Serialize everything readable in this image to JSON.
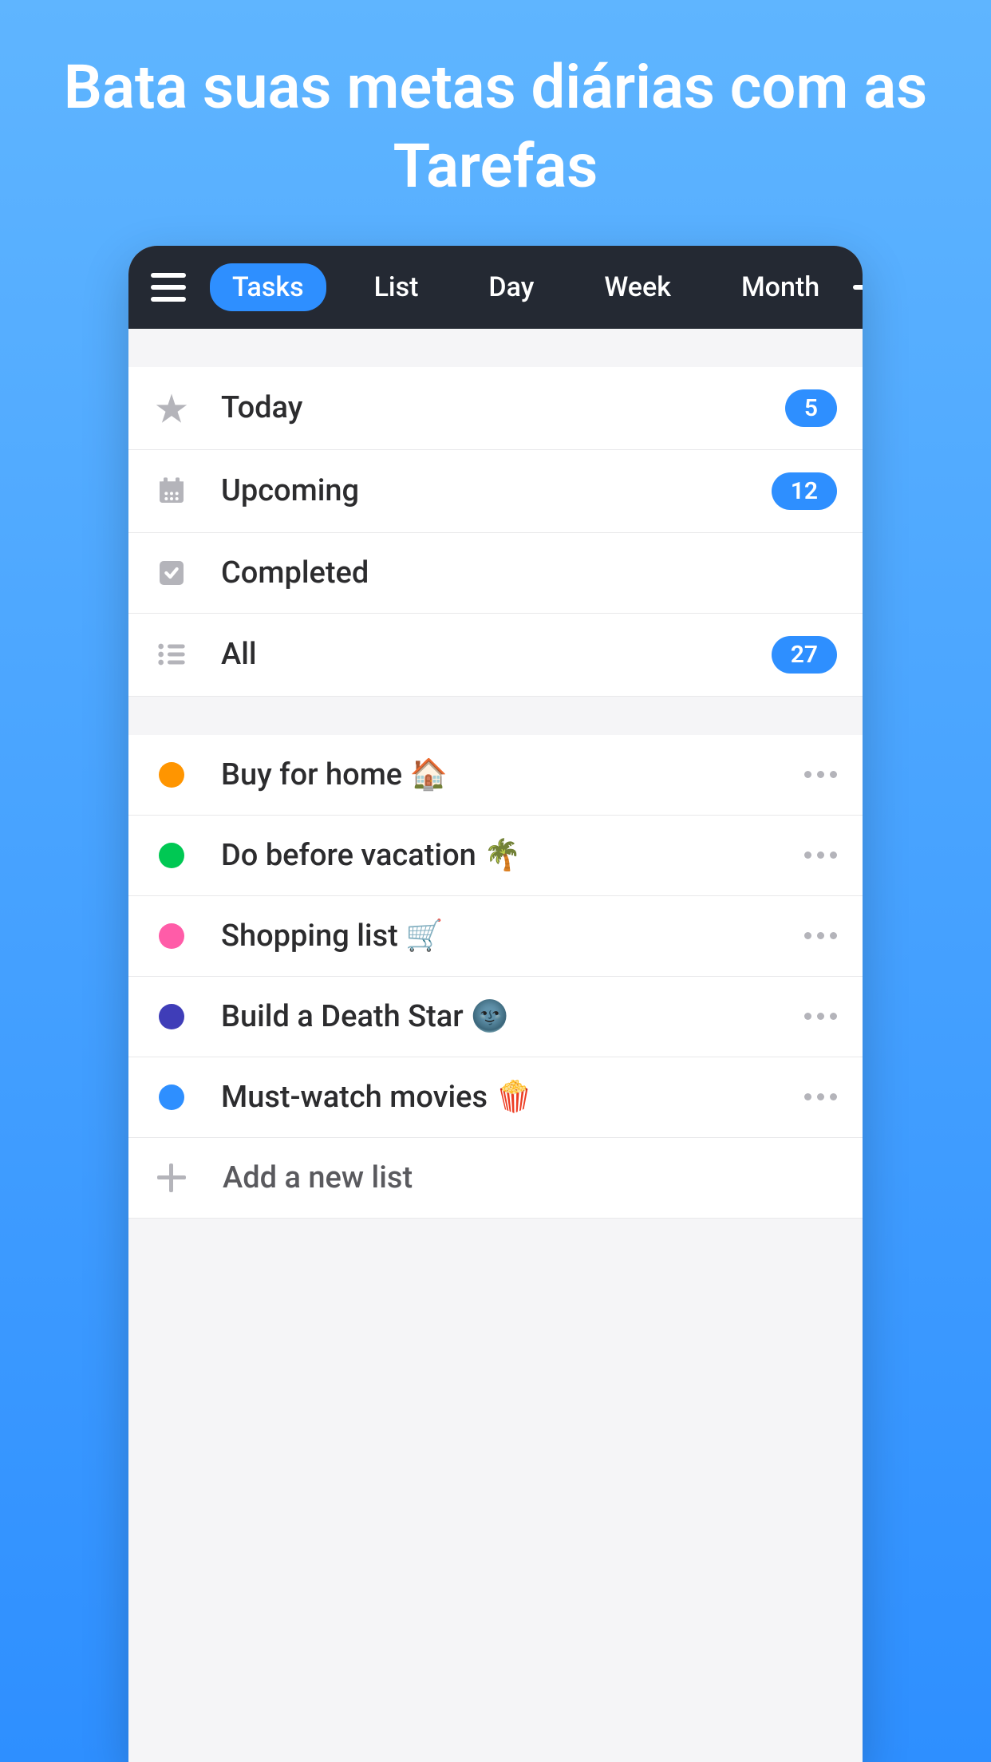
{
  "headline": "Bata suas metas diárias com as Tarefas",
  "header": {
    "tabs": [
      {
        "label": "Tasks",
        "active": true
      },
      {
        "label": "List",
        "active": false
      },
      {
        "label": "Day",
        "active": false
      },
      {
        "label": "Week",
        "active": false
      },
      {
        "label": "Month",
        "active": false
      }
    ]
  },
  "smartLists": [
    {
      "icon": "star",
      "label": "Today",
      "count": 5
    },
    {
      "icon": "calendar",
      "label": "Upcoming",
      "count": 12
    },
    {
      "icon": "check",
      "label": "Completed",
      "count": null
    },
    {
      "icon": "list",
      "label": "All",
      "count": 27
    }
  ],
  "userLists": [
    {
      "color": "#ff9500",
      "label": "Buy for home 🏠"
    },
    {
      "color": "#00c853",
      "label": "Do before vacation 🌴"
    },
    {
      "color": "#ff5ca8",
      "label": "Shopping list 🛒"
    },
    {
      "color": "#3f3db8",
      "label": "Build a Death Star 🌚"
    },
    {
      "color": "#2e8fff",
      "label": "Must-watch movies 🍿"
    }
  ],
  "addListLabel": "Add a new list"
}
